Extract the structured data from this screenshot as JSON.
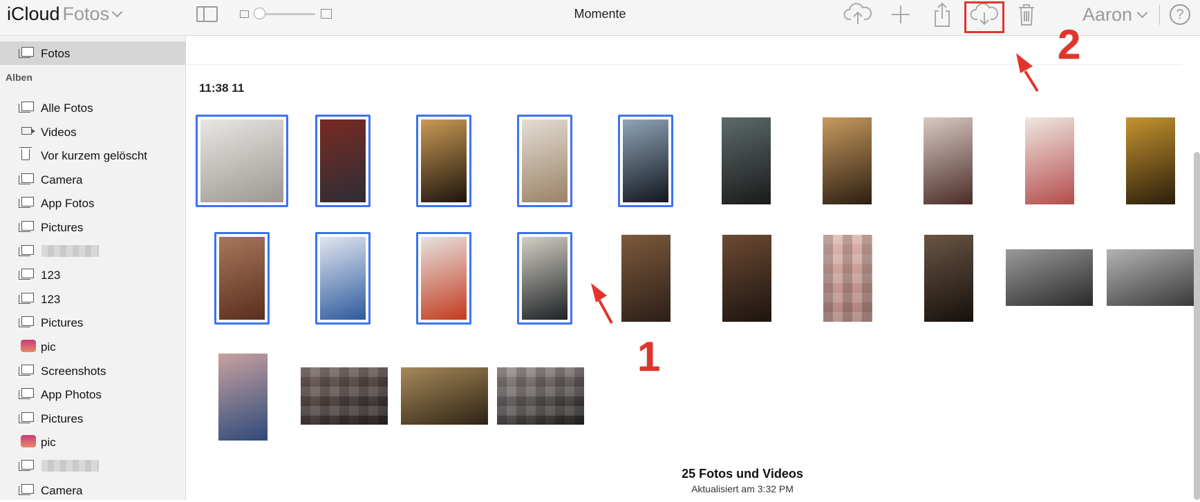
{
  "topbar": {
    "brand": "iCloud",
    "app_name": "Fotos",
    "view_title": "Momente",
    "user_name": "Aaron",
    "help_symbol": "?",
    "icons": [
      "sidebar-toggle-icon",
      "zoom-small-icon",
      "zoom-large-icon",
      "upload-icon",
      "add-icon",
      "share-icon",
      "download-icon",
      "trash-icon",
      "chevron-down-icon",
      "help-icon"
    ],
    "zoom_level": 0.05
  },
  "sidebar": {
    "top_item": "Fotos",
    "albums_heading": "Alben",
    "albums": [
      {
        "label": "Alle Fotos",
        "icon": "album-icon"
      },
      {
        "label": "Videos",
        "icon": "video-icon"
      },
      {
        "label": "Vor kurzem gelöscht",
        "icon": "trash-icon"
      },
      {
        "label": "Camera",
        "icon": "album-icon"
      },
      {
        "label": "App Fotos",
        "icon": "album-icon"
      },
      {
        "label": "Pictures",
        "icon": "album-icon"
      },
      {
        "label": "",
        "icon": "album-icon",
        "redacted": true
      },
      {
        "label": "123",
        "icon": "album-icon"
      },
      {
        "label": "123",
        "icon": "album-icon"
      },
      {
        "label": "Pictures",
        "icon": "album-icon"
      },
      {
        "label": "pic",
        "icon": "pic-thumbnail-icon"
      },
      {
        "label": "Screenshots",
        "icon": "album-icon"
      },
      {
        "label": "App Photos",
        "icon": "album-icon"
      },
      {
        "label": "Pictures",
        "icon": "album-icon"
      },
      {
        "label": "pic",
        "icon": "pic-thumbnail-icon"
      },
      {
        "label": "",
        "icon": "album-icon",
        "redacted": true
      },
      {
        "label": "Camera",
        "icon": "album-icon"
      }
    ]
  },
  "main": {
    "moment_title": "11:38 11",
    "photos": [
      {
        "subject": "white cat",
        "selected": true,
        "c1": "#e9e6e3",
        "c2": "#9b9792"
      },
      {
        "subject": "canal street",
        "selected": true,
        "c1": "#7a2a22",
        "c2": "#2c2e36"
      },
      {
        "subject": "castle stairs",
        "selected": true,
        "c1": "#c99a55",
        "c2": "#1e140c"
      },
      {
        "subject": "park bench",
        "selected": true,
        "c1": "#e3ddd4",
        "c2": "#9a8265"
      },
      {
        "subject": "vintage car",
        "selected": true,
        "c1": "#8fa4b7",
        "c2": "#12161e"
      },
      {
        "subject": "old car",
        "selected": false,
        "c1": "#5d6a6a",
        "c2": "#1a1a1a"
      },
      {
        "subject": "dashboard",
        "selected": false,
        "c1": "#c79a5e",
        "c2": "#2c1e12"
      },
      {
        "subject": "cupcake",
        "selected": false,
        "c1": "#d9c9c3",
        "c2": "#4a2c28"
      },
      {
        "subject": "heart cupcake",
        "selected": false,
        "c1": "#f0e7e0",
        "c2": "#b34c4c"
      },
      {
        "subject": "gramophone",
        "selected": false,
        "c1": "#c6932f",
        "c2": "#2a1e0c"
      },
      {
        "subject": "breakfast",
        "selected": true,
        "c1": "#a8765c",
        "c2": "#5a2e1e"
      },
      {
        "subject": "blue stairs",
        "selected": true,
        "c1": "#dfe6ef",
        "c2": "#2e5a9e"
      },
      {
        "subject": "red flower",
        "selected": true,
        "c1": "#e7e2df",
        "c2": "#c23b1f"
      },
      {
        "subject": "leaf",
        "selected": true,
        "c1": "#d3cec4",
        "c2": "#1c2124"
      },
      {
        "subject": "antique shop",
        "selected": false,
        "c1": "#7d5a3d",
        "c2": "#2c1e16"
      },
      {
        "subject": "coffee table",
        "selected": false,
        "c1": "#6d4a32",
        "c2": "#1c1410"
      },
      {
        "subject": "pixelated",
        "selected": false,
        "c1": "#e3bcb2",
        "c2": "#a87b74",
        "pixelated": true
      },
      {
        "subject": "camera",
        "selected": false,
        "c1": "#6a5544",
        "c2": "#15100c"
      },
      {
        "subject": "phone hand",
        "selected": false,
        "c1": "#9a9a9a",
        "c2": "#2a2a2a"
      },
      {
        "subject": "phone hand 2",
        "selected": false,
        "c1": "#b3b3b3",
        "c2": "#3a3a3a"
      },
      {
        "subject": "winter lake",
        "selected": false,
        "c1": "#c9a1a0",
        "c2": "#2d4a7a"
      },
      {
        "subject": "pixelated dark",
        "selected": false,
        "c1": "#7a6a66",
        "c2": "#2a2422",
        "pixelated": true
      },
      {
        "subject": "iphone hand",
        "selected": false,
        "c1": "#a78a5a",
        "c2": "#2e2214"
      },
      {
        "subject": "pixelated grey",
        "selected": false,
        "c1": "#9a9090",
        "c2": "#262222",
        "pixelated": true
      }
    ],
    "footer_count": "25 Fotos und Videos",
    "footer_updated": "Aktualisiert am 3:32 PM"
  },
  "annotations": {
    "step1": "1",
    "step2": "2",
    "accent": "#e3342b",
    "selection_color": "#3b72f4"
  }
}
